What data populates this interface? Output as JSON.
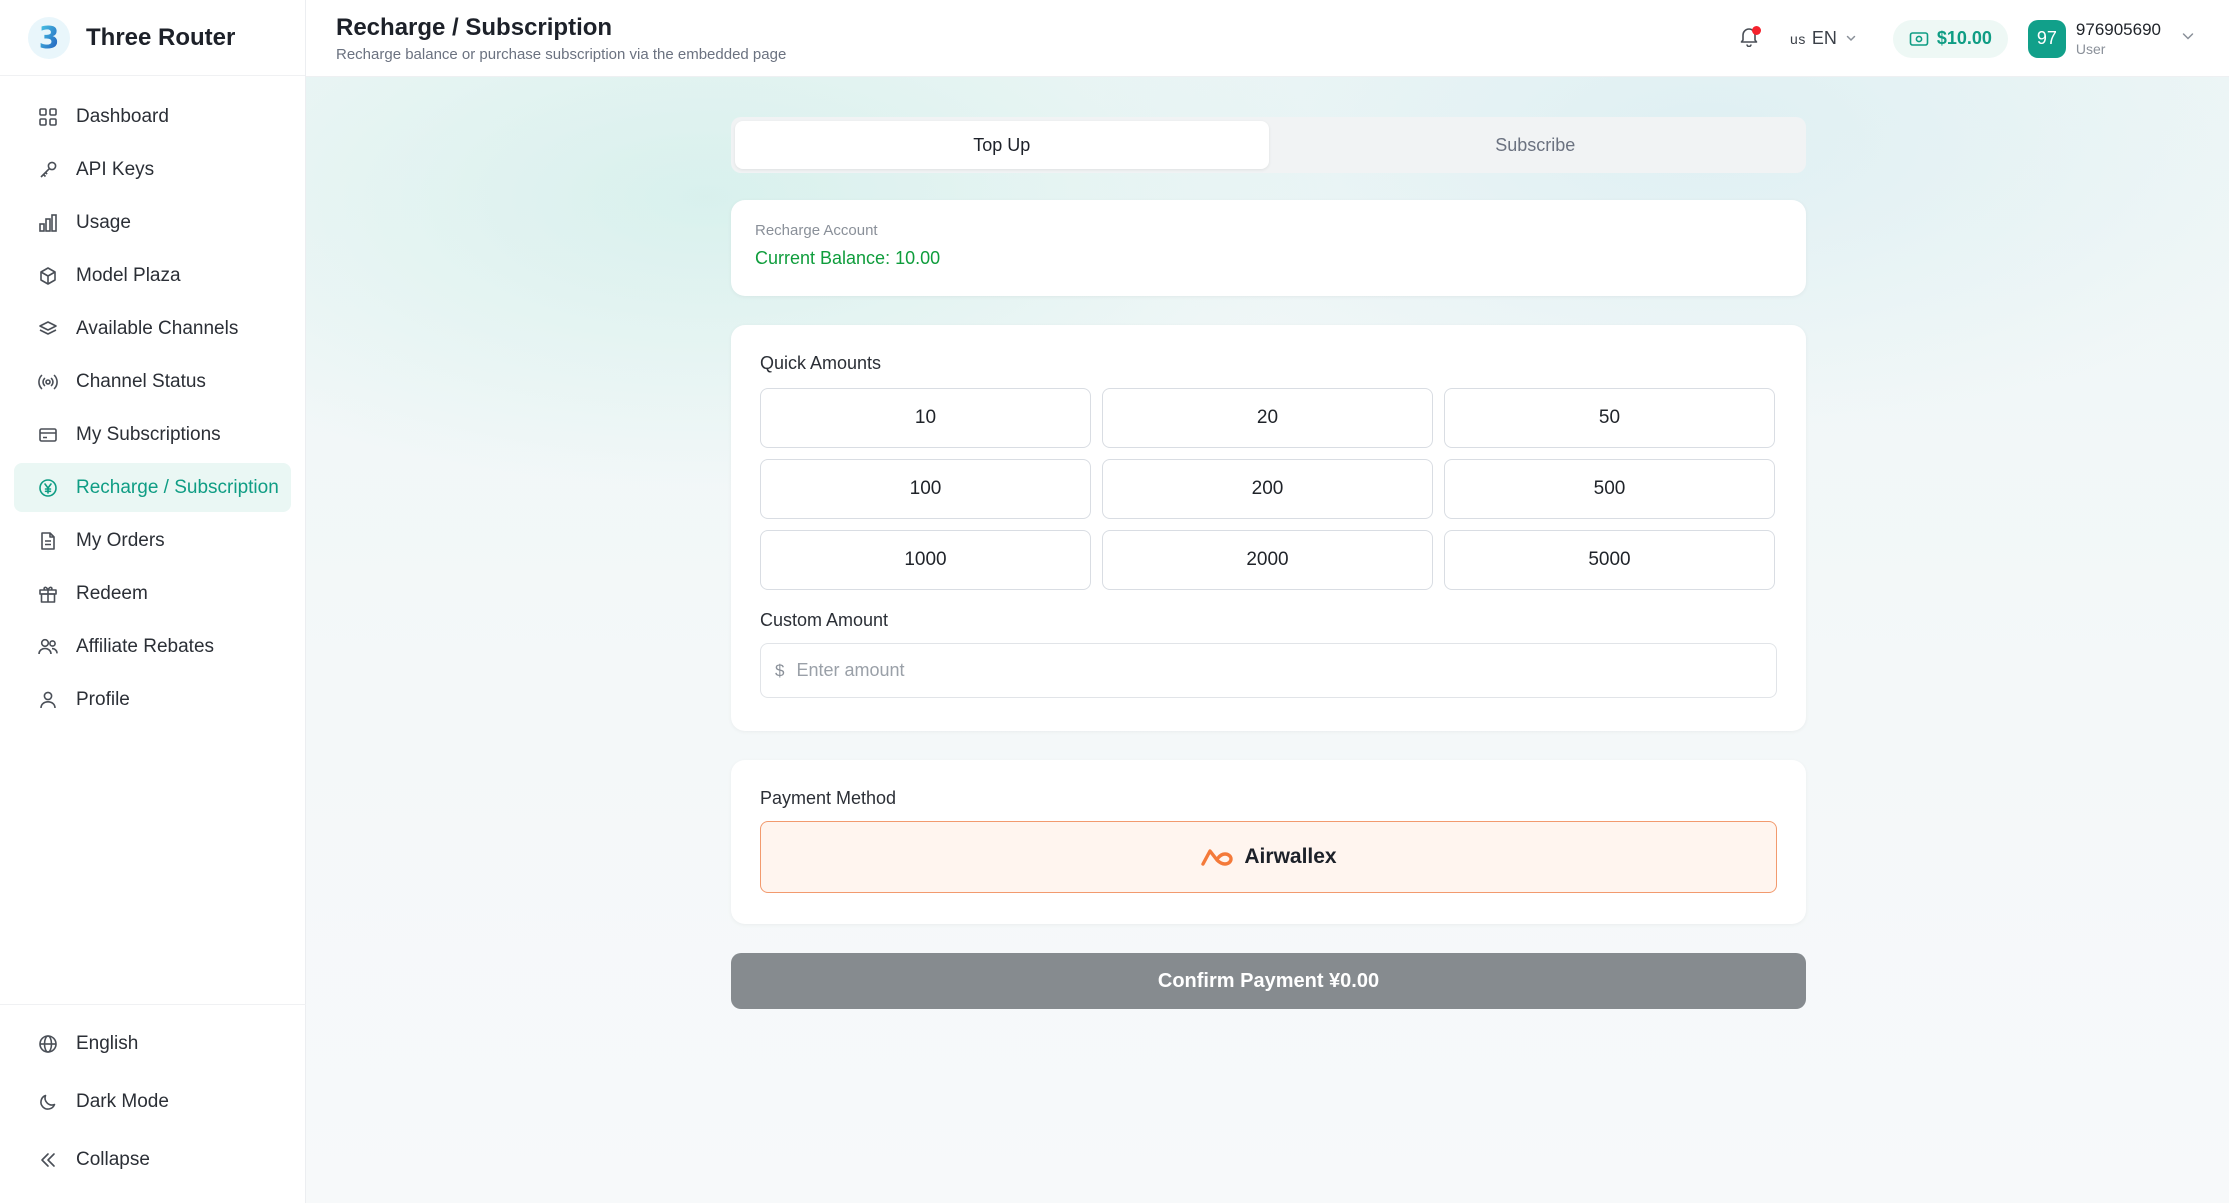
{
  "brand": {
    "name": "Three Router",
    "logo_glyph": "3",
    "logo_icon": "three-router-logo"
  },
  "colors": {
    "accent": "#0f9d84",
    "active_bg": "#eaf7f4",
    "balance_green": "#0f9d3c",
    "payment_border": "#f29a6e",
    "confirm_bg": "#868b8f",
    "notification_dot": "#f5222d"
  },
  "sidebar": {
    "items": [
      {
        "label": "Dashboard",
        "icon": "dashboard-grid-icon",
        "active": false
      },
      {
        "label": "API Keys",
        "icon": "key-icon",
        "active": false
      },
      {
        "label": "Usage",
        "icon": "bar-chart-icon",
        "active": false
      },
      {
        "label": "Model Plaza",
        "icon": "cube-icon",
        "active": false
      },
      {
        "label": "Available Channels",
        "icon": "layers-icon",
        "active": false
      },
      {
        "label": "Channel Status",
        "icon": "broadcast-icon",
        "active": false
      },
      {
        "label": "My Subscriptions",
        "icon": "card-icon",
        "active": false
      },
      {
        "label": "Recharge / Subscription",
        "icon": "yen-circle-icon",
        "active": true
      },
      {
        "label": "My Orders",
        "icon": "document-icon",
        "active": false
      },
      {
        "label": "Redeem",
        "icon": "gift-icon",
        "active": false
      },
      {
        "label": "Affiliate Rebates",
        "icon": "users-icon",
        "active": false
      },
      {
        "label": "Profile",
        "icon": "user-icon",
        "active": false
      }
    ],
    "bottom": [
      {
        "label": "English",
        "icon": "globe-icon"
      },
      {
        "label": "Dark Mode",
        "icon": "moon-icon"
      },
      {
        "label": "Collapse",
        "icon": "double-chevron-left-icon"
      }
    ]
  },
  "header": {
    "title": "Recharge / Subscription",
    "subtitle": "Recharge balance or purchase subscription via the embedded page",
    "lang_flag": "us",
    "lang_code": "EN",
    "balance": "$10.00",
    "user": {
      "avatar": "97",
      "name": "976905690",
      "role": "User"
    }
  },
  "tabs": [
    {
      "label": "Top Up",
      "active": true
    },
    {
      "label": "Subscribe",
      "active": false
    }
  ],
  "account": {
    "label": "Recharge Account",
    "balance_text": "Current Balance: 10.00"
  },
  "amounts": {
    "label": "Quick Amounts",
    "options": [
      "10",
      "20",
      "50",
      "100",
      "200",
      "500",
      "1000",
      "2000",
      "5000"
    ],
    "custom_label": "Custom Amount",
    "currency_symbol": "$",
    "custom_placeholder": "Enter amount",
    "custom_value": ""
  },
  "payment": {
    "label": "Payment Method",
    "method": "Airwallex",
    "method_icon": "airwallex-logo"
  },
  "confirm": {
    "label": "Confirm Payment ¥0.00"
  }
}
